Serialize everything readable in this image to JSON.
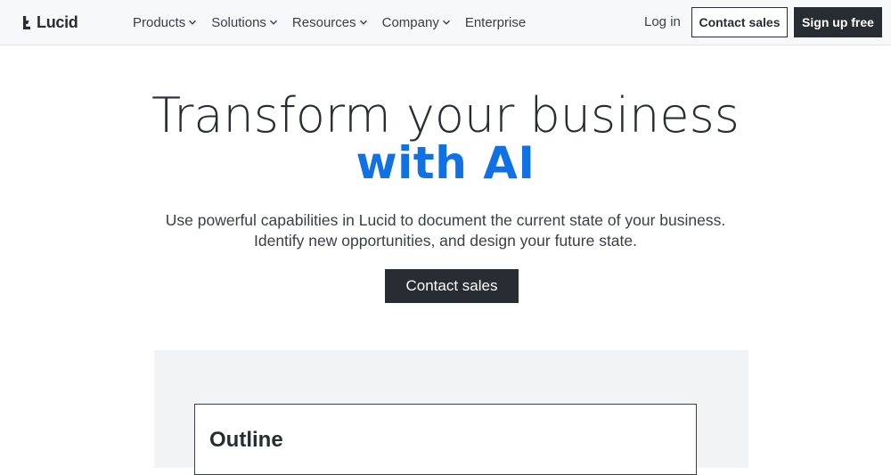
{
  "brand": {
    "name": "Lucid"
  },
  "nav": {
    "items": [
      {
        "label": "Products",
        "has_dropdown": true,
        "icon": "chevron-down-icon"
      },
      {
        "label": "Solutions",
        "has_dropdown": true,
        "icon": "chevron-down-icon"
      },
      {
        "label": "Resources",
        "has_dropdown": true,
        "icon": "chevron-down-icon"
      },
      {
        "label": "Company",
        "has_dropdown": true,
        "icon": "chevron-down-icon"
      },
      {
        "label": "Enterprise",
        "has_dropdown": false
      }
    ],
    "login_label": "Log in",
    "contact_label": "Contact sales",
    "signup_label": "Sign up free"
  },
  "hero": {
    "title_line1": "Transform your business",
    "title_line2": "with AI",
    "subtitle_line1": "Use powerful capabilities in Lucid to document the current state of your business.",
    "subtitle_line2": "Identify new opportunities, and design your future state.",
    "cta_label": "Contact sales"
  },
  "preview": {
    "card_title": "Outline"
  },
  "colors": {
    "accent": "#1071e5",
    "dark": "#282c33",
    "header_bg": "#f7f8fa",
    "panel_bg": "#f2f3f5"
  }
}
